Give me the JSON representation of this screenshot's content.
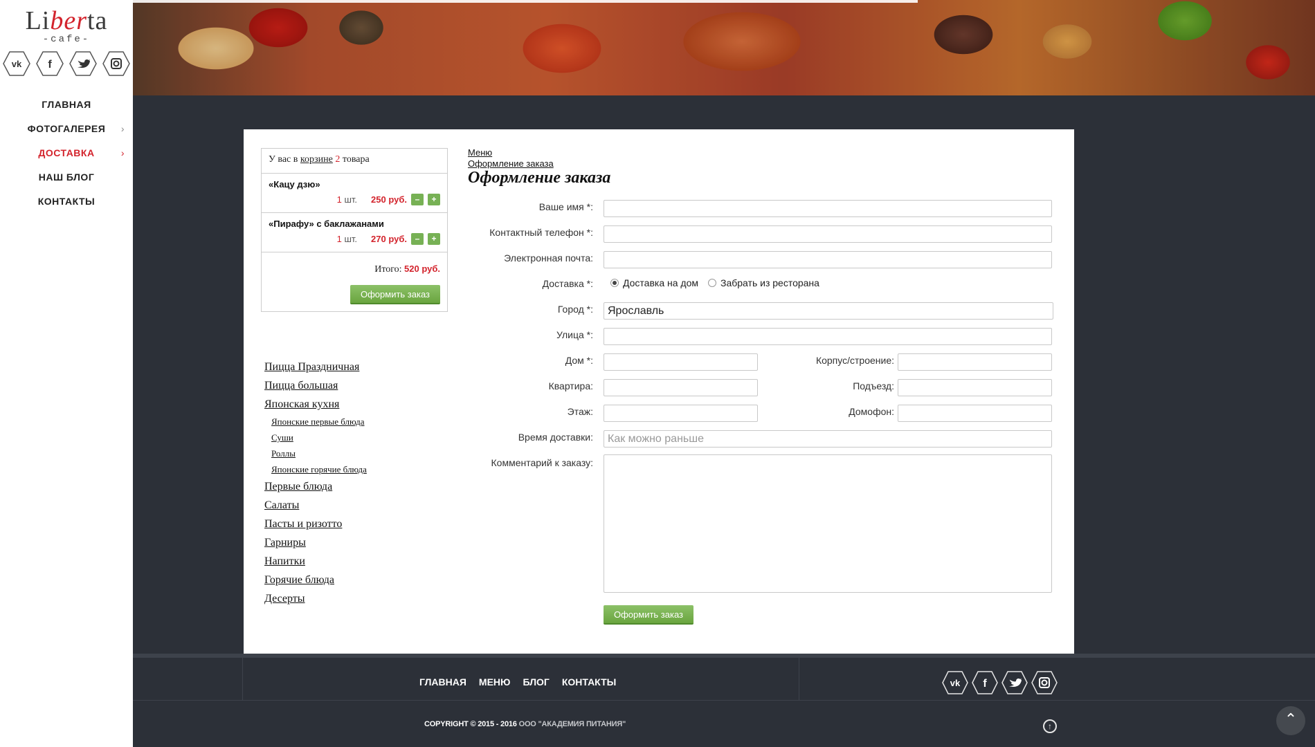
{
  "brand": {
    "name_part1": "Li",
    "name_part2": "b",
    "name_part3": "er",
    "name_part4": "ta",
    "subtitle": "-cafe-"
  },
  "social": [
    "vk",
    "facebook",
    "twitter",
    "instagram"
  ],
  "sidebar": {
    "items": [
      {
        "label": "ГЛАВНАЯ",
        "active": false,
        "has_children": false
      },
      {
        "label": "ФОТОГАЛЕРЕЯ",
        "active": false,
        "has_children": true
      },
      {
        "label": "ДОСТАВКА",
        "active": true,
        "has_children": true
      },
      {
        "label": "НАШ БЛОГ",
        "active": false,
        "has_children": false
      },
      {
        "label": "КОНТАКТЫ",
        "active": false,
        "has_children": false
      }
    ]
  },
  "cart": {
    "head_prefix": "У вас в",
    "head_link": "корзине",
    "head_count": "2",
    "head_suffix": "товара",
    "items": [
      {
        "name": "«Кацу дзю»",
        "qty": "1",
        "unit": "шт.",
        "price": "250 руб."
      },
      {
        "name": "«Пирафу» с баклажанами",
        "qty": "1",
        "unit": "шт.",
        "price": "270 руб."
      }
    ],
    "minus": "–",
    "plus": "+",
    "total_label": "Итого:",
    "total_value": "520 руб.",
    "checkout_label": "Оформить заказ"
  },
  "categories": [
    {
      "label": "Пицца Праздничная",
      "sub": false
    },
    {
      "label": "Пицца большая",
      "sub": false
    },
    {
      "label": "Японская кухня",
      "sub": false
    },
    {
      "label": "Японские первые блюда",
      "sub": true
    },
    {
      "label": "Суши",
      "sub": true
    },
    {
      "label": "Роллы",
      "sub": true
    },
    {
      "label": "Японские горячие блюда",
      "sub": true
    },
    {
      "label": "Первые блюда",
      "sub": false
    },
    {
      "label": "Салаты",
      "sub": false
    },
    {
      "label": "Пасты и ризотто",
      "sub": false
    },
    {
      "label": "Гарниры",
      "sub": false
    },
    {
      "label": "Напитки",
      "sub": false
    },
    {
      "label": "Горячие блюда",
      "sub": false
    },
    {
      "label": "Десерты",
      "sub": false
    }
  ],
  "breadcrumb": [
    "Меню",
    "Оформление заказа"
  ],
  "page_title": "Оформление заказа",
  "form": {
    "name_label": "Ваше имя *:",
    "phone_label": "Контактный телефон *:",
    "email_label": "Электронная почта:",
    "delivery_label": "Доставка *:",
    "delivery_opt1": "Доставка на дом",
    "delivery_opt2": "Забрать из ресторана",
    "city_label": "Город *:",
    "city_value": "Ярославль",
    "street_label": "Улица *:",
    "house_label": "Дом *:",
    "building_label": "Корпус/строение:",
    "apt_label": "Квартира:",
    "entrance_label": "Подъезд:",
    "floor_label": "Этаж:",
    "intercom_label": "Домофон:",
    "time_label": "Время доставки:",
    "time_placeholder": "Как можно раньше",
    "comment_label": "Комментарий к заказу:",
    "submit_label": "Оформить заказ"
  },
  "footer": {
    "nav": [
      "ГЛАВНАЯ",
      "МЕНЮ",
      "БЛОГ",
      "КОНТАКТЫ"
    ],
    "copyright_main": "COPYRIGHT © 2015 - 2016",
    "copyright_company": "ООО \"АКАДЕМИЯ ПИТАНИЯ\"",
    "up_arrow": "↑",
    "scroll_top": "⌃"
  },
  "colors": {
    "accent": "#d3232c",
    "button": "#77b155",
    "dark": "#2c3038"
  }
}
